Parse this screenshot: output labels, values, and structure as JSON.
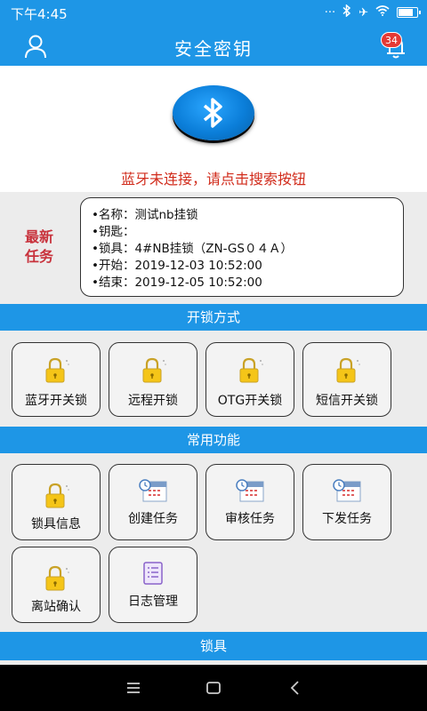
{
  "status_bar": {
    "time": "下午4:45",
    "battery_level": 0.85
  },
  "app_bar": {
    "title": "安全密钥",
    "notification_count": "34"
  },
  "bluetooth": {
    "status_text": "蓝牙未连接，请点击搜索按钮"
  },
  "latest_task": {
    "label_line1": "最新",
    "label_line2": "任务",
    "name": "•名称：测试nb挂锁",
    "key": "•钥匙：",
    "lock": "•锁具：4#NB挂锁（ZN-GS０４Ａ）",
    "start": "•开始：2019-12-03 10:52:00",
    "end": "•结束：2019-12-05 10:52:00"
  },
  "unlock_methods": {
    "title": "开锁方式",
    "items": [
      {
        "label": "蓝牙开关锁",
        "icon": "padlock-icon"
      },
      {
        "label": "远程开锁",
        "icon": "padlock-icon"
      },
      {
        "label": "OTG开关锁",
        "icon": "padlock-icon"
      },
      {
        "label": "短信开关锁",
        "icon": "padlock-icon"
      }
    ]
  },
  "common_functions": {
    "title": "常用功能",
    "items": [
      {
        "label": "锁具信息",
        "icon": "padlock-icon"
      },
      {
        "label": "创建任务",
        "icon": "calendar-clock-icon"
      },
      {
        "label": "审核任务",
        "icon": "calendar-clock-icon"
      },
      {
        "label": "下发任务",
        "icon": "calendar-clock-icon"
      },
      {
        "label": "离站确认",
        "icon": "padlock-icon"
      },
      {
        "label": "日志管理",
        "icon": "log-document-icon"
      }
    ]
  },
  "locks_section": {
    "title": "锁具"
  },
  "colors": {
    "primary": "#1e96e6",
    "alert_red": "#d12b1b",
    "task_label": "#c8323c"
  }
}
